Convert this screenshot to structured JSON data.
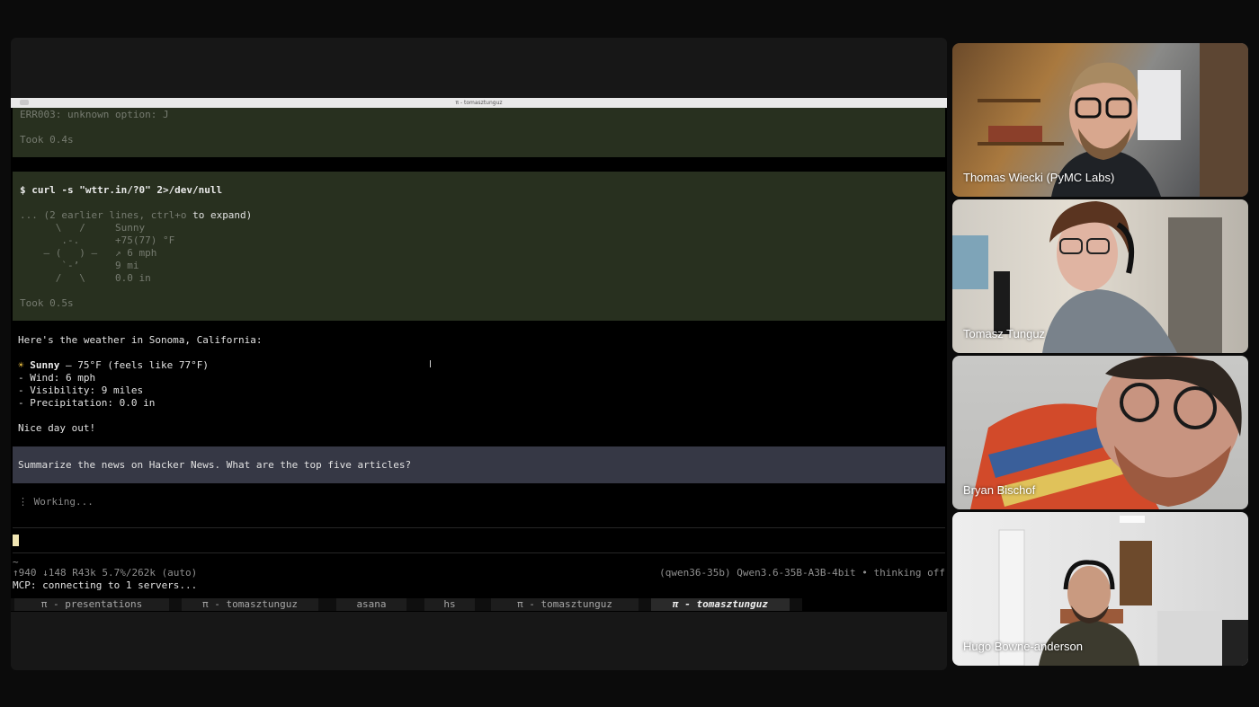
{
  "terminal": {
    "window_title": "π - tomasztunguz",
    "tool1": {
      "error": "ERR003: unknown option: J",
      "took": "Took 0.4s"
    },
    "tool2": {
      "command": "$ curl -s \"wttr.in/?0\" 2>/dev/null",
      "earlier_prefix": "... (2 earlier lines, ",
      "earlier_key": "ctrl+o",
      "earlier_suffix": " to expand)",
      "ascii_lines": [
        "      \\   /     Sunny",
        "       .-.      +75(77) °F",
        "    ― (   ) ―   ↗ 6 mph",
        "       `-’      9 mi",
        "      /   \\     0.0 in"
      ],
      "took": "Took 0.5s"
    },
    "response": {
      "intro": "Here's the weather in Sonoma, California:",
      "sun_icon": "☀",
      "condition": "Sunny",
      "condition_rest": " — 75°F (feels like 77°F)",
      "wind": "- Wind: 6 mph",
      "visibility": "- Visibility: 9 miles",
      "precip": "- Precipitation: 0.0 in",
      "closing": "Nice day out!"
    },
    "user_message": "Summarize the news on Hacker News. What are the top five articles?",
    "working": {
      "spinner": "⋮",
      "text": "Working..."
    },
    "status": {
      "tilde": "~",
      "left": "↑940 ↓148 R43k 5.7%/262k (auto)",
      "right": "(qwen36-35b) Qwen3.6-35B-A3B-4bit • thinking off",
      "mcp": "MCP: connecting to 1 servers..."
    },
    "tabs": [
      "π - presentations",
      "π - tomasztunguz",
      "asana",
      "hs",
      "π - tomasztunguz",
      "π - tomasztunguz"
    ],
    "active_tab_index": 5
  },
  "participants": [
    {
      "name": "Thomas Wiecki (PyMC Labs)"
    },
    {
      "name": "Tomasz Tunguz"
    },
    {
      "name": "Bryan Bischof"
    },
    {
      "name": "Hugo Bowne-anderson"
    }
  ]
}
